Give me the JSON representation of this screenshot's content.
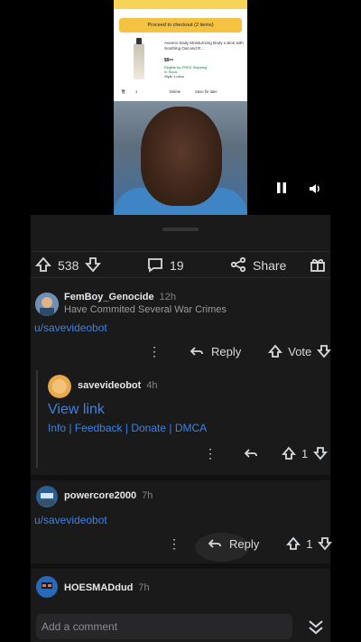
{
  "video": {
    "checkout_label": "Proceed to checkout (2 items)",
    "product_title": "Aveeno Daily Moisturizing Body Lotion with Soothing Oat and R...",
    "price": "$9⁸⁸",
    "shipping": "Eligible for FREE Shipping",
    "stock": "In Stock",
    "variant": "Style: Lotion",
    "qty": "1",
    "delete_label": "Delete",
    "save_label": "Save for later",
    "pause_icon": "pause-icon",
    "volume_icon": "volume-icon"
  },
  "actions": {
    "upvote_count": "538",
    "comment_count": "19",
    "share_label": "Share"
  },
  "comments": [
    {
      "username": "FemBoy_Genocide",
      "age": "12h",
      "flair": "Have Commited Several War Crimes",
      "body": "u/savevideobot",
      "reply_label": "Reply",
      "vote_label": "Vote"
    },
    {
      "username": "savevideobot",
      "age": "4h",
      "link_title": "View link",
      "links": [
        "Info",
        "Feedback",
        "Donate",
        "DMCA"
      ],
      "score": "1"
    },
    {
      "username": "powercore2000",
      "age": "7h",
      "body": "u/savevideobot",
      "reply_label": "Reply",
      "score": "1"
    },
    {
      "username": "HOESMADdud",
      "age": "7h"
    }
  ],
  "comment_input": {
    "placeholder": "Add a comment"
  },
  "colors": {
    "link_blue": "#3b82e6",
    "sheet_bg": "#1a1a1b",
    "accent_yellow": "#f5c242"
  }
}
